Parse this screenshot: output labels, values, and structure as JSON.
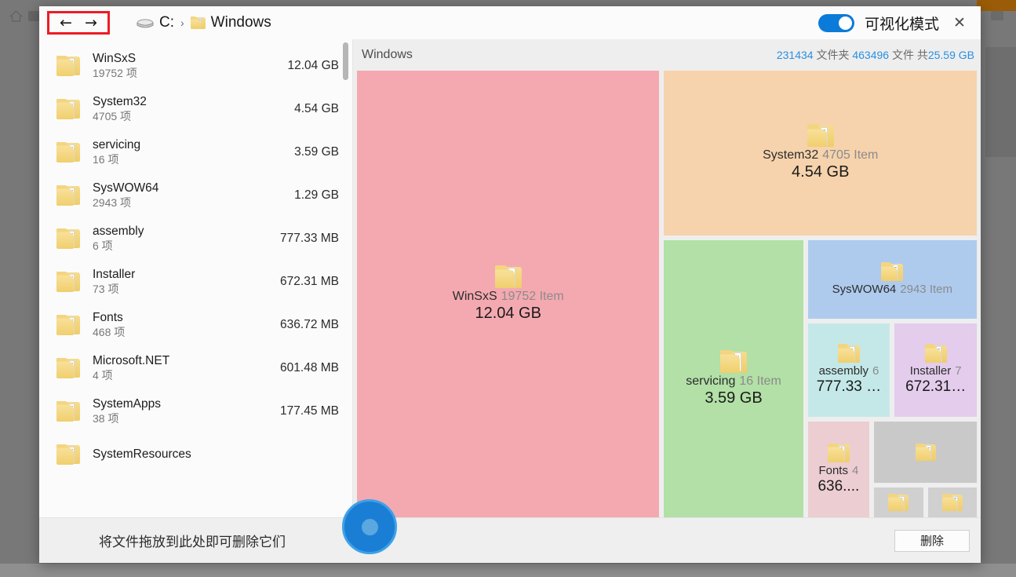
{
  "window": {
    "nav": {
      "back_label": "←",
      "forward_label": "→"
    },
    "breadcrumb": {
      "drive": "C:",
      "separator": "›",
      "folder": "Windows"
    },
    "toggle_label": "可视化模式",
    "close_label": "✕",
    "accent_blue": "#0a7bd8",
    "highlight_red": "#ee1c24"
  },
  "file_list": {
    "count_suffix": "项",
    "rows": [
      {
        "name": "WinSxS",
        "count": "19752 项",
        "size": "12.04 GB"
      },
      {
        "name": "System32",
        "count": "4705 项",
        "size": "4.54 GB"
      },
      {
        "name": "servicing",
        "count": "16 项",
        "size": "3.59 GB"
      },
      {
        "name": "SysWOW64",
        "count": "2943 项",
        "size": "1.29 GB"
      },
      {
        "name": "assembly",
        "count": "6 项",
        "size": "777.33 MB"
      },
      {
        "name": "Installer",
        "count": "73 项",
        "size": "672.31 MB"
      },
      {
        "name": "Fonts",
        "count": "468 项",
        "size": "636.72 MB"
      },
      {
        "name": "Microsoft.NET",
        "count": "4 项",
        "size": "601.48 MB"
      },
      {
        "name": "SystemApps",
        "count": "38 项",
        "size": "177.45 MB"
      },
      {
        "name": "SystemResources",
        "count": "",
        "size": ""
      }
    ]
  },
  "treemap": {
    "title": "Windows",
    "stats": {
      "folders_num": "231434",
      "folders_label": "文件夹",
      "files_num": "463496",
      "files_label": "文件",
      "total_label": "共",
      "total_num": "25.59 GB"
    },
    "tiles": [
      {
        "name": "WinSxS",
        "count": "19752 Item",
        "size": "12.04 GB",
        "color": "#f4a9b0"
      },
      {
        "name": "System32",
        "count": "4705 Item",
        "size": "4.54 GB",
        "color": "#f6d3ac"
      },
      {
        "name": "servicing",
        "count": "16 Item",
        "size": "3.59 GB",
        "color": "#b2e0a6"
      },
      {
        "name": "SysWOW64",
        "count": "2943 Item",
        "size": "",
        "color": "#aecbee"
      },
      {
        "name": "assembly",
        "count": "6",
        "size": "777.33 …",
        "color": "#c4e8e8"
      },
      {
        "name": "Installer",
        "count": "7",
        "size": "672.31…",
        "color": "#e3ccec"
      },
      {
        "name": "Fonts",
        "count": "4",
        "size": "636....",
        "color": "#eccdd2"
      },
      {
        "name": "",
        "count": "",
        "size": "",
        "color": "#c9c9c9"
      },
      {
        "name": "",
        "count": "",
        "size": "",
        "color": "#d0d0d0"
      },
      {
        "name": "",
        "count": "",
        "size": "",
        "color": "#d0d0d0"
      }
    ]
  },
  "dropbar": {
    "hint": "将文件拖放到此处即可删除它们",
    "delete_label": "删除"
  }
}
